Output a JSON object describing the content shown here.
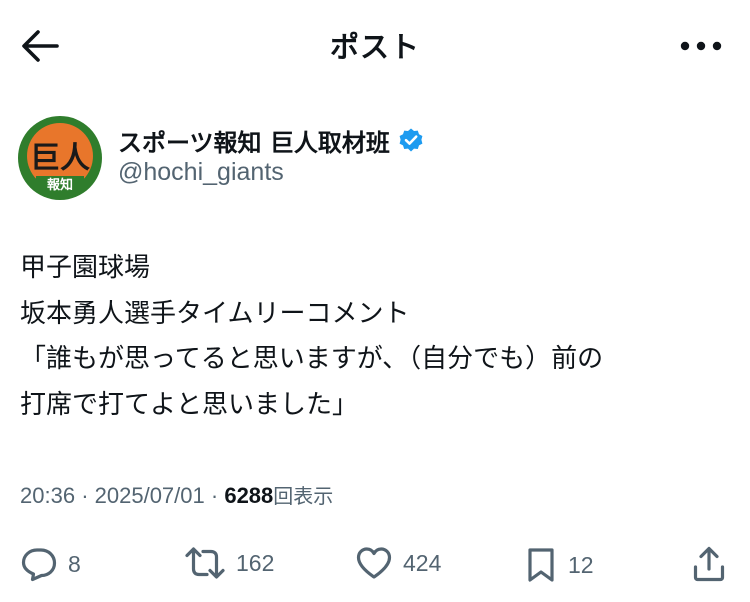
{
  "header": {
    "title": "ポスト",
    "back_icon": "arrow-left-icon",
    "more_icon": "more-horizontal-icon"
  },
  "author": {
    "display_name": "スポーツ報知 巨人取材班",
    "handle": "@hochi_giants",
    "verified": true,
    "avatar": {
      "logo_text_top": "巨人",
      "logo_text_bottom": "報知",
      "bg_color": "#2f7d2c",
      "inner_color": "#e8762b"
    }
  },
  "tweet": {
    "lines": [
      "甲子園球場",
      "坂本勇人選手タイムリーコメント",
      "「誰もが思ってると思いますが、（自分でも）前の",
      "打席で打てよと思いました」"
    ]
  },
  "meta": {
    "time": "20:36",
    "separator": "·",
    "date": "2025/07/01",
    "views_count": "6288",
    "views_label": "回表示"
  },
  "actions": {
    "reply": {
      "icon": "reply-icon",
      "count": "8"
    },
    "retweet": {
      "icon": "retweet-icon",
      "count": "162"
    },
    "like": {
      "icon": "heart-icon",
      "count": "424"
    },
    "bookmark": {
      "icon": "bookmark-icon",
      "count": "12"
    },
    "share": {
      "icon": "share-icon"
    }
  },
  "colors": {
    "text_primary": "#0f1419",
    "text_secondary": "#536471",
    "verified_blue": "#1d9bf0"
  }
}
